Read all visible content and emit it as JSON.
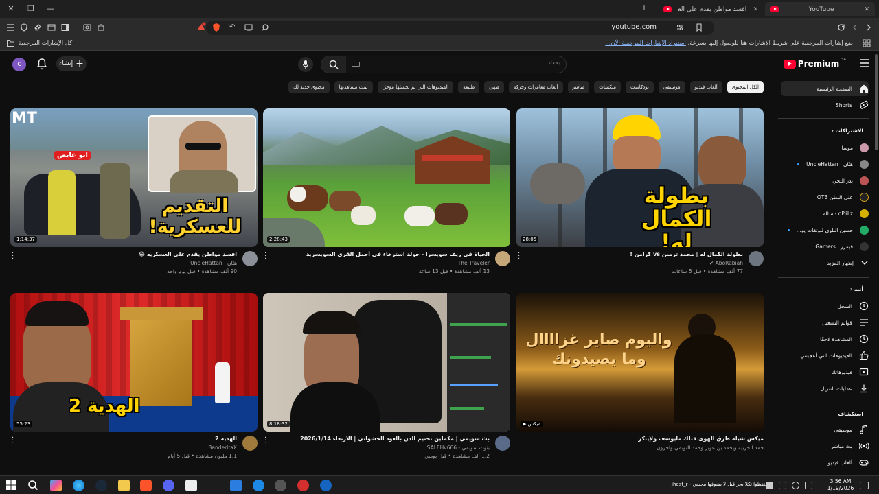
{
  "browser": {
    "active_tab_title": "YouTube",
    "second_tab_title": "افسد مواطن يقدم على العسكريه - YouTube",
    "url": "youtube.com",
    "bookmarks_all": "كل الإشارات المرجعية",
    "bookmarks_hint": "ضع إشارات المرجعية على شريط الإشارات هنا للوصول إليها بسرعة.",
    "bookmarks_import": "استيراد الإشارات المرجعية الآن..."
  },
  "masthead": {
    "avatar_letter": "c",
    "create_label": "إنشاء",
    "search_placeholder": "بحث",
    "logo_text": "Premium",
    "logo_sup": "SA"
  },
  "chips": [
    {
      "label": "الكل المحتوى",
      "active": true
    },
    {
      "label": "ألعاب فيديو",
      "active": false
    },
    {
      "label": "موسيقى",
      "active": false
    },
    {
      "label": "بودكاست",
      "active": false
    },
    {
      "label": "ميكسات",
      "active": false
    },
    {
      "label": "مباشر",
      "active": false
    },
    {
      "label": "ألعاب مغامرات وحركة",
      "active": false
    },
    {
      "label": "طهي",
      "active": false
    },
    {
      "label": "طبيعة",
      "active": false
    },
    {
      "label": "الفيديوهات التي تم تحميلها مؤخرًا",
      "active": false
    },
    {
      "label": "تمت مشاهدتها",
      "active": false
    },
    {
      "label": "محتوى جديد لك",
      "active": false
    }
  ],
  "sidebar": {
    "home": "الصفحة الرئيسية",
    "shorts": "Shorts",
    "subscriptions_title": "الاشتراكات",
    "subscriptions": [
      {
        "name": "موسا",
        "color": "#c9a",
        "dot": false
      },
      {
        "name": "هتّان | UncleHattan",
        "color": "#888",
        "dot": true
      },
      {
        "name": "بدر التحي",
        "color": "#b55",
        "dot": false
      },
      {
        "name": "على البطن OTB",
        "color": "#222",
        "dot": false
      },
      {
        "name": "oPiiLz - سالم",
        "color": "#d4b000",
        "dot": false
      },
      {
        "name": "حسين البلوي للوثقات يو...",
        "color": "#2a6",
        "dot": true
      },
      {
        "name": "قيمرز | Gamers",
        "color": "#333",
        "dot": false
      }
    ],
    "show_more": "إظهار المزيد",
    "you_title": "أنت",
    "you_items": [
      "السجل",
      "قوائم التشغيل",
      "المشاهدة لاحقًا",
      "الفيديوهات التي أعجبتني",
      "فيديوهاتك",
      "عمليات التنزيل"
    ],
    "explore_title": "استكشاف",
    "explore_items": [
      "موسيقى",
      "بث مباشر",
      "ألعاب فيديو"
    ]
  },
  "videos": [
    {
      "title": "افسد مواطن يقدم على العسكريه 😂",
      "channel": "هتّان | UncleHattan",
      "stats": "90 ألف مشاهدة • قبل يوم واحد",
      "duration": "1:14:37",
      "thumb_text": "التقديم للعسكرية!",
      "thumb_label": "ابو عايض",
      "badge": "MT"
    },
    {
      "title": "الحياة في ريف سويسرا - جولة استرخاء في أجمل القرى السويسرية",
      "channel": "The Traveler",
      "stats": "13 ألف مشاهدة • قبل 13 ساعة",
      "duration": "2:28:43"
    },
    {
      "title": "بطولة الكمال له | محمد ترمبن vs كرامن !",
      "channel": "AboRabiah",
      "stats": "77 ألف مشاهدة • قبل 5 ساعات",
      "duration": "28:05",
      "thumb_text": "بطولة الكمال له!"
    },
    {
      "title": "الهدية 2",
      "channel": "BanderitaX",
      "stats": "1.1 مليون مشاهدة • قبل 5 أيام",
      "duration": "55:23",
      "thumb_text": "الهدية 2"
    },
    {
      "title": "بث سويمي | مكملين تختيم الدن بالعود الحشواني | الأربعاء 2026/1/14",
      "channel": "بثوث سويمي - SALEHv666",
      "stats": "1.2 ألف مشاهدة • قبل يومين",
      "duration": "8:18:32"
    },
    {
      "title": "ميكس شيلة طرق الهوى قبلك مايوسف ولإيتكر",
      "channel": "حمد الحربيه ويحمد بن عوير وحمد التويمي وآخرون",
      "stats": "",
      "duration": "ميكس",
      "thumb_text": "واليوم صاير غزاااال وما يصيدونك"
    }
  ],
  "taskbar": {
    "time": "3:56 AM",
    "date": "1/19/2026",
    "notification": "احتفظوا تكلا بحر قبل لا يشوفها محيمن - jhest_r"
  },
  "colors": {
    "bg": "#0f0f0f",
    "accent_red": "#ff0033",
    "chip_bg": "#272727"
  }
}
